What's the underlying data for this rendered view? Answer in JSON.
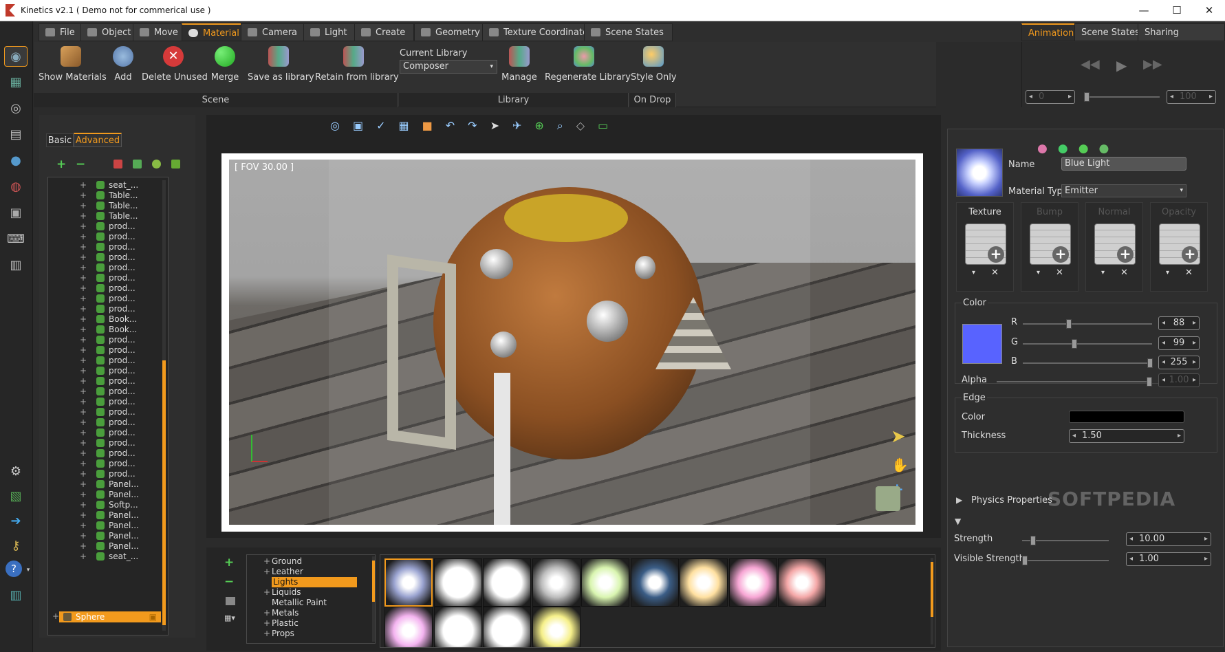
{
  "window": {
    "title": "Kinetics v2.1 ( Demo not for commerical use )",
    "minimize": "—",
    "maximize": "☐",
    "close": "✕"
  },
  "menu": {
    "tabs": [
      {
        "label": "File"
      },
      {
        "label": "Object"
      },
      {
        "label": "Move"
      },
      {
        "label": "Material"
      },
      {
        "label": "Camera"
      },
      {
        "label": "Light"
      },
      {
        "label": "Create"
      },
      {
        "label": "Geometry"
      },
      {
        "label": "Texture Coordinates"
      },
      {
        "label": "Scene States"
      }
    ],
    "active": "Material",
    "right_tabs": [
      {
        "label": "Animation"
      },
      {
        "label": "Scene States"
      },
      {
        "label": "Sharing Resources"
      }
    ]
  },
  "ribbon": {
    "scene_buttons": [
      {
        "label": "Show Materials"
      },
      {
        "label": "Add"
      },
      {
        "label": "Delete Unused"
      },
      {
        "label": "Merge"
      },
      {
        "label": "Save as library"
      },
      {
        "label": "Retain from library"
      }
    ],
    "current_library_label": "Current Library",
    "current_library_value": "Composer",
    "library_buttons": [
      {
        "label": "Manage"
      },
      {
        "label": "Regenerate Library"
      }
    ],
    "ondrop_buttons": [
      {
        "label": "Style Only"
      }
    ],
    "groups": {
      "scene": "Scene",
      "library": "Library",
      "ondrop": "On Drop"
    }
  },
  "animation": {
    "frame_start": "0",
    "frame_end": "100"
  },
  "left_panel": {
    "tabs": [
      {
        "label": "Basic"
      },
      {
        "label": "Advanced"
      }
    ],
    "active_tab": "Advanced",
    "tree_items": [
      "seat_...",
      "Table...",
      "Table...",
      "Table...",
      "prod...",
      "prod...",
      "prod...",
      "prod...",
      "prod...",
      "prod...",
      "prod...",
      "prod...",
      "prod...",
      "Book...",
      "Book...",
      "prod...",
      "prod...",
      "prod...",
      "prod...",
      "prod...",
      "prod...",
      "prod...",
      "prod...",
      "prod...",
      "prod...",
      "prod...",
      "prod...",
      "prod...",
      "prod...",
      "Panel...",
      "Panel...",
      "Softp...",
      "Panel...",
      "Panel...",
      "Panel...",
      "Panel...",
      "seat_..."
    ],
    "selected_item": "Sphere"
  },
  "viewport": {
    "fov_label": "[ FOV 30.00 ]"
  },
  "library_tree": {
    "items": [
      {
        "label": "Ground",
        "expandable": true
      },
      {
        "label": "Leather",
        "expandable": true
      },
      {
        "label": "Lights",
        "expandable": false,
        "selected": true
      },
      {
        "label": "Liquids",
        "expandable": true
      },
      {
        "label": "Metallic Paint",
        "expandable": false
      },
      {
        "label": "Metals",
        "expandable": true
      },
      {
        "label": "Plastic",
        "expandable": true
      },
      {
        "label": "Props",
        "expandable": true
      }
    ]
  },
  "thumbnails": [
    {
      "color": "#9aa3d0"
    },
    {
      "color": "#ffffff"
    },
    {
      "color": "#ffffff"
    },
    {
      "color": "#bdbdbd"
    },
    {
      "color": "#d9f5b0"
    },
    {
      "color": "#3b5d86"
    },
    {
      "color": "#ffe0a0"
    },
    {
      "color": "#f7a6d4"
    },
    {
      "color": "#f4a7a7"
    },
    {
      "color": "#f4b4f0"
    },
    {
      "color": "#ffffff"
    },
    {
      "color": "#ffffff"
    },
    {
      "color": "#f6f08a"
    }
  ],
  "material": {
    "name_label": "Name",
    "name_value": "Blue Light",
    "type_label": "Material Type",
    "type_value": "Emitter",
    "texture_slots": [
      {
        "label": "Texture"
      },
      {
        "label": "Bump"
      },
      {
        "label": "Normal"
      },
      {
        "label": "Opacity"
      }
    ],
    "color_section": "Color",
    "r_label": "R",
    "r_value": "88",
    "g_label": "G",
    "g_value": "99",
    "b_label": "B",
    "b_value": "255",
    "alpha_label": "Alpha",
    "alpha_value": "1.00",
    "swatch_color": "#5863ff",
    "edge_section": "Edge",
    "edge_color_label": "Color",
    "thickness_label": "Thickness",
    "thickness_value": "1.50",
    "physics_label": "Physics Properties",
    "strength_label": "Strength",
    "strength_value": "10.00",
    "visible_strength_label": "Visible Strength",
    "visible_strength_value": "1.00"
  },
  "watermark": "SOFTPEDIA"
}
